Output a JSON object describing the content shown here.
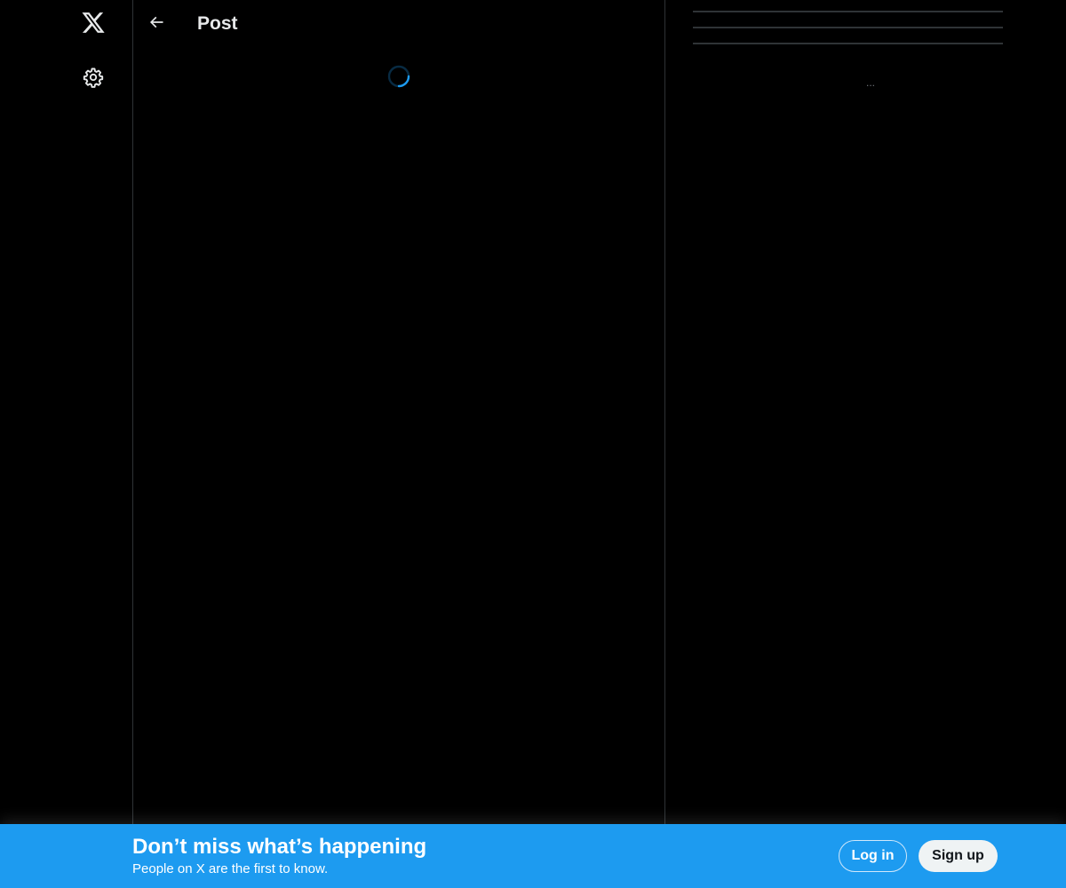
{
  "nav": {
    "logo_icon": "x-logo-icon",
    "settings_icon": "gear-icon"
  },
  "header": {
    "back_icon": "arrow-left-icon",
    "title": "Post"
  },
  "main": {
    "loading": true
  },
  "sidebar": {
    "more_indicator": "..."
  },
  "banner": {
    "title": "Don’t miss what’s happening",
    "subtitle": "People on X are the first to know.",
    "login_label": "Log in",
    "signup_label": "Sign up"
  },
  "colors": {
    "background": "#000000",
    "accent": "#1d9bf0",
    "divider": "#2f3336",
    "text_primary": "#e7e9ea",
    "signup_bg": "#eff3f4"
  }
}
